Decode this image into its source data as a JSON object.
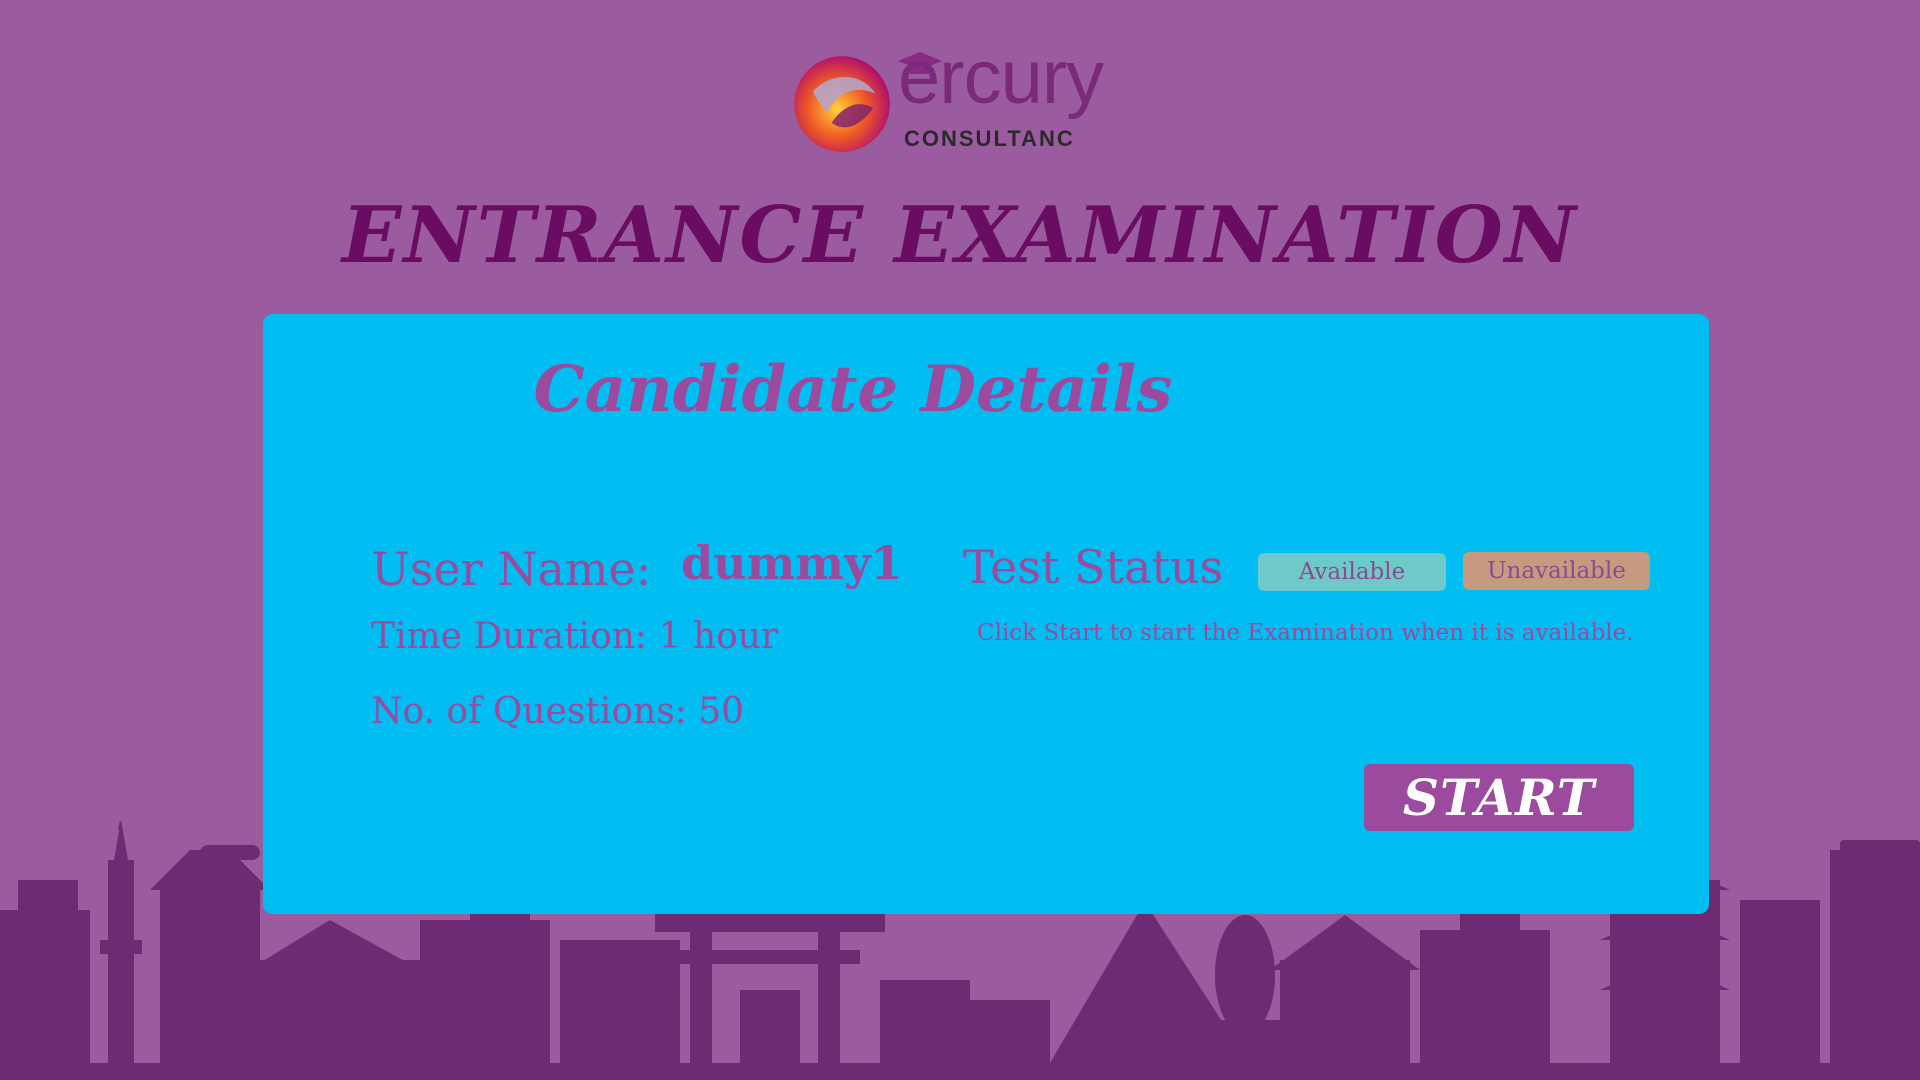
{
  "brand": {
    "name": "ercury",
    "sub": "CONSULTANC"
  },
  "page": {
    "title": "ENTRANCE EXAMINATION"
  },
  "card": {
    "title": "Candidate Details",
    "user_name_label": "User Name:",
    "user_name_value": "dummy1",
    "time_duration": "Time Duration: 1 hour",
    "questions": "No. of Questions: 50",
    "test_status_label": "Test Status",
    "status_available": "Available",
    "status_unavailable": "Unavailable",
    "hint": "Click Start to start the Examination when it is available.",
    "start_label": "START"
  },
  "colors": {
    "background": "#9a5b9f",
    "skyline": "#6e2b72",
    "title": "#6a0d62",
    "card": "#00bdf2",
    "text": "#9b4a9e",
    "available": "#6ec9c9",
    "unavailable": "#c79a80"
  },
  "icons": {
    "logo": "mercury-logo-icon",
    "skyline": "city-skyline-illustration"
  }
}
